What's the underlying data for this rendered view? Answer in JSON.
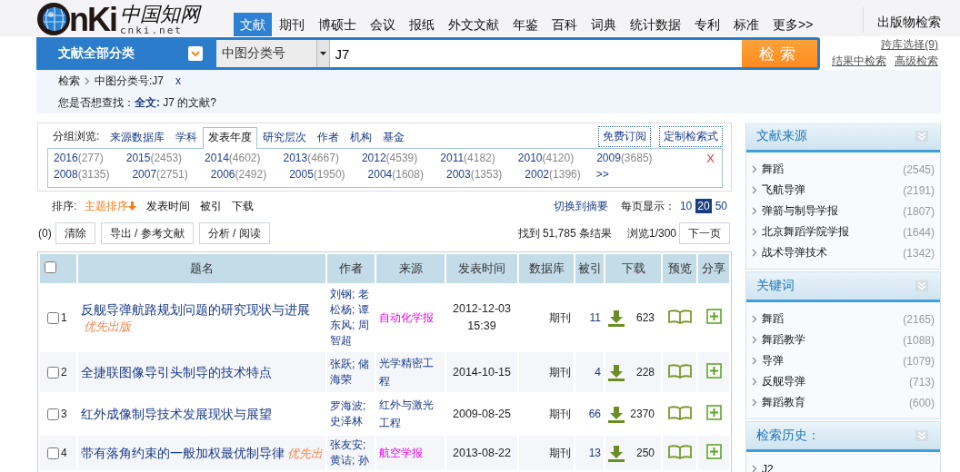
{
  "logo": {
    "wordmark": "nKi",
    "chinese_name": "中国知网",
    "domain": "cnki.net"
  },
  "nav": {
    "tabs": [
      {
        "label": "文献",
        "selected": true
      },
      {
        "label": "期刊",
        "selected": false
      },
      {
        "label": "博硕士",
        "selected": false
      },
      {
        "label": "会议",
        "selected": false
      },
      {
        "label": "报纸",
        "selected": false
      },
      {
        "label": "外文文献",
        "selected": false
      },
      {
        "label": "年鉴",
        "selected": false
      },
      {
        "label": "百科",
        "selected": false
      },
      {
        "label": "词典",
        "selected": false
      },
      {
        "label": "统计数据",
        "selected": false
      },
      {
        "label": "专利",
        "selected": false
      },
      {
        "label": "标准",
        "selected": false
      },
      {
        "label": "更多>>",
        "selected": false
      }
    ],
    "publication_search": "出版物检索"
  },
  "search": {
    "category": "文献全部分类",
    "field": "中图分类号",
    "value": "J7",
    "button": "检索",
    "cross_db": "跨库选择(9)",
    "links": [
      "结果中检索",
      "高级检索"
    ]
  },
  "breadcrumb": {
    "items": [
      "检索",
      "中图分类号:J7"
    ],
    "remove": "x"
  },
  "suggestion": "您是否想查找：**全文:** J7 的文献?",
  "group_browse": {
    "label": "分组浏览:",
    "tabs": [
      {
        "label": "来源数据库",
        "selected": false
      },
      {
        "label": "学科",
        "selected": false
      },
      {
        "label": "发表年度",
        "selected": true
      },
      {
        "label": "研究层次",
        "selected": false
      },
      {
        "label": "作者",
        "selected": false
      },
      {
        "label": "机构",
        "selected": false
      },
      {
        "label": "基金",
        "selected": false
      }
    ],
    "buttons": [
      "免费订阅",
      "定制检索式"
    ],
    "years": [
      {
        "year": "2016",
        "count": "(277)"
      },
      {
        "year": "2015",
        "count": "(2453)"
      },
      {
        "year": "2014",
        "count": "(4602)"
      },
      {
        "year": "2013",
        "count": "(4667)"
      },
      {
        "year": "2012",
        "count": "(4539)"
      },
      {
        "year": "2011",
        "count": "(4182)"
      },
      {
        "year": "2010",
        "count": "(4120)"
      },
      {
        "year": "2009",
        "count": "(3685)"
      },
      {
        "year": "2008",
        "count": "(3135)"
      },
      {
        "year": "2007",
        "count": "(2751)"
      },
      {
        "year": "2006",
        "count": "(2492)"
      },
      {
        "year": "2005",
        "count": "(1950)"
      },
      {
        "year": "2004",
        "count": "(1608)"
      },
      {
        "year": "2003",
        "count": "(1353)"
      },
      {
        "year": "2002",
        "count": "(1396)"
      }
    ],
    "more": ">>",
    "close": "X"
  },
  "sort": {
    "label": "排序:",
    "options": [
      {
        "label": "主题排序",
        "selected": true
      },
      {
        "label": "发表时间",
        "selected": false
      },
      {
        "label": "被引",
        "selected": false
      },
      {
        "label": "下载",
        "selected": false
      }
    ],
    "switch_view": "切换到摘要",
    "per_page_label": "每页显示：",
    "per_page": [
      {
        "label": "10",
        "selected": false
      },
      {
        "label": "20",
        "selected": true
      },
      {
        "label": "50",
        "selected": false
      }
    ]
  },
  "actions": {
    "selected_count": "(0)",
    "buttons": [
      "清除",
      "导出 / 参考文献",
      "分析 / 阅读"
    ],
    "found": "找到 51,785 条结果",
    "page": "浏览1/300",
    "next": "下一页"
  },
  "table": {
    "all_checked": false,
    "columns": [
      "题名",
      "作者",
      "来源",
      "发表时间",
      "数据库",
      "被引",
      "下载",
      "预览",
      "分享"
    ],
    "rows": [
      {
        "checked": false,
        "number": "1",
        "title": "反舰导弹航路规划问题的研究现状与进展",
        "badge": "优先出版",
        "authors": "刘钢; 老松杨; 谭东风; 周智超",
        "source": {
          "name": "自动化学报",
          "highlighted": true
        },
        "date": "2012-12-03",
        "time": "15:39",
        "database": "期刊",
        "cited": "11",
        "downloads": "623"
      },
      {
        "checked": false,
        "number": "2",
        "title": "全捷联图像导引头制导的技术特点",
        "authors": "张跃; 储海荣",
        "source": {
          "name": "光学精密工程",
          "highlighted": false
        },
        "date": "2014-10-15",
        "database": "期刊",
        "cited": "4",
        "downloads": "228"
      },
      {
        "checked": false,
        "number": "3",
        "title": "红外成像制导技术发展现状与展望",
        "authors": "罗海波; 史泽林",
        "source": {
          "name": "红外与激光工程",
          "highlighted": false
        },
        "date": "2009-08-25",
        "database": "期刊",
        "cited": "66",
        "downloads": "2370"
      },
      {
        "checked": false,
        "number": "4",
        "title": "带有落角约束的一般加权最优制导律",
        "badge": "优先出",
        "authors": "张友安; 黄诘; 孙",
        "source": {
          "name": "航空学报",
          "highlighted": true
        },
        "date": "2013-08-22",
        "database": "期刊",
        "cited": "13",
        "downloads": "250"
      }
    ]
  },
  "sidebar": [
    {
      "title": "文献来源",
      "items": [
        {
          "label": "舞蹈",
          "count": "(2545)"
        },
        {
          "label": "飞航导弹",
          "count": "(2191)"
        },
        {
          "label": "弹箭与制导学报",
          "count": "(1807)"
        },
        {
          "label": "北京舞蹈学院学报",
          "count": "(1644)"
        },
        {
          "label": "战术导弹技术",
          "count": "(1342)"
        }
      ]
    },
    {
      "title": "关键词",
      "items": [
        {
          "label": "舞蹈",
          "count": "(2165)"
        },
        {
          "label": "舞蹈教学",
          "count": "(1088)"
        },
        {
          "label": "导弹",
          "count": "(1079)"
        },
        {
          "label": "反舰导弹",
          "count": "(713)"
        },
        {
          "label": "舞蹈教育",
          "count": "(600)"
        }
      ]
    },
    {
      "title": "检索历史：",
      "items": [
        {
          "label": "J2"
        }
      ]
    }
  ]
}
